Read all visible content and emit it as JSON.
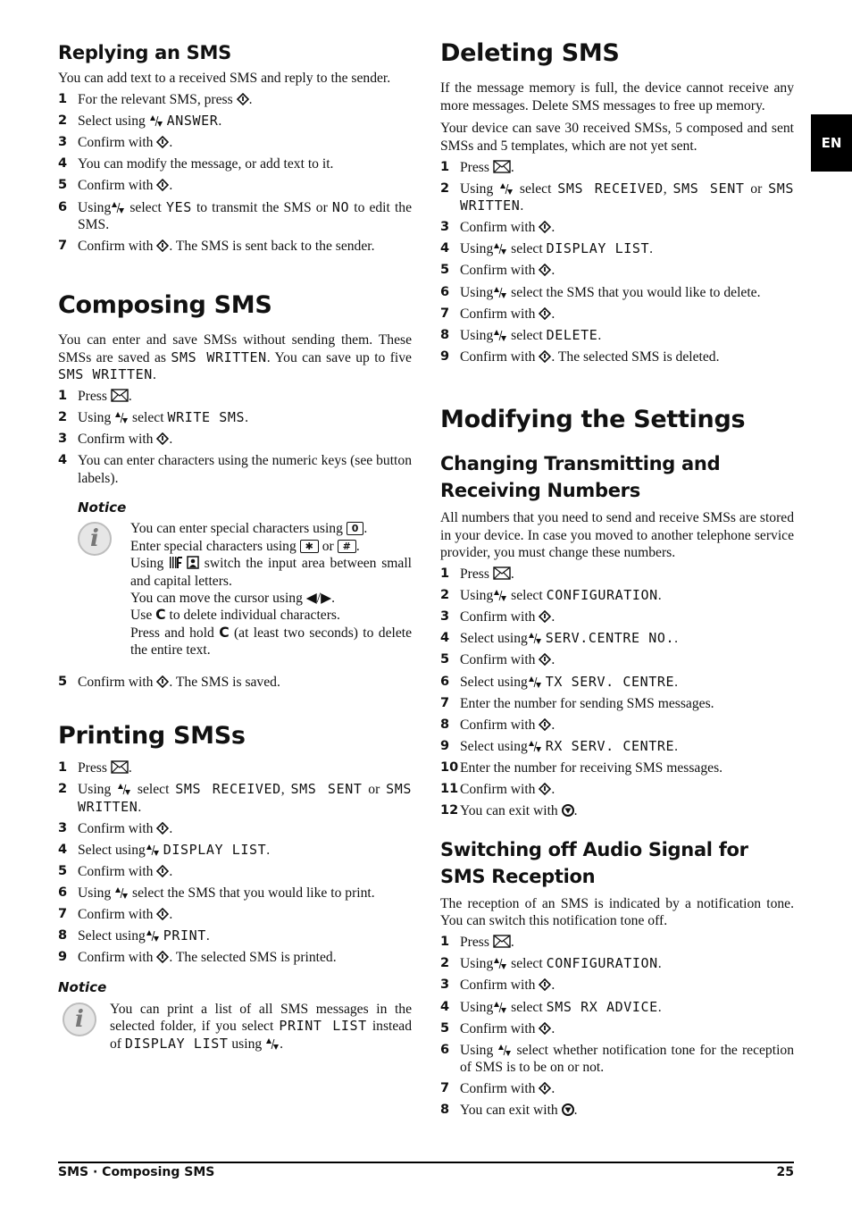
{
  "language_tab": "EN",
  "footer": {
    "section": "SMS · Composing SMS",
    "page_number": "25"
  },
  "icons": {
    "confirm": "ok-diamond-icon",
    "envelope": "envelope-icon",
    "updown": "up-down-arrows-icon",
    "stop": "stop-icon",
    "info": "info-icon"
  },
  "replying": {
    "title": "Replying an SMS",
    "intro": "You can add text to a received SMS and reply to the sender.",
    "steps": [
      {
        "n": "1",
        "pre": "For the relevant SMS, press ",
        "post": "."
      },
      {
        "n": "2",
        "pre": "Select using ",
        "lcd": "ANSWER",
        "post": "."
      },
      {
        "n": "3",
        "pre": "Confirm with ",
        "post": "."
      },
      {
        "n": "4",
        "text": "You can modify the message, or add text to it."
      },
      {
        "n": "5",
        "pre": "Confirm with ",
        "post": "."
      },
      {
        "n": "6",
        "pre": "Using",
        "mid": " select ",
        "lcd1": "YES",
        "mid2": " to transmit the SMS or ",
        "lcd2": "NO",
        "post": " to edit the SMS."
      },
      {
        "n": "7",
        "pre": "Confirm with ",
        "post": ". The SMS is sent back to the sender."
      }
    ]
  },
  "composing": {
    "title": "Composing SMS",
    "intro_a": "You can enter and save SMSs without sending them. These SMSs are saved as ",
    "intro_lcd1": "SMS WRITTEN",
    "intro_b": ". You can save up to five ",
    "intro_lcd2": "SMS WRITTEN",
    "intro_c": ".",
    "steps": [
      {
        "n": "1",
        "pre": "Press ",
        "post": "."
      },
      {
        "n": "2",
        "pre": "Using ",
        "mid": " select ",
        "lcd": "WRITE SMS",
        "post": "."
      },
      {
        "n": "3",
        "pre": "Confirm with ",
        "post": "."
      },
      {
        "n": "4",
        "text": "You can enter characters using the numeric keys (see button labels)."
      },
      {
        "n": "5",
        "pre": "Confirm with ",
        "post": ". The SMS is saved."
      }
    ],
    "notice": {
      "title": "Notice",
      "l1_pre": "You can enter special characters using ",
      "key0": "0",
      "l1_post": ".",
      "l2_pre": "Enter special characters using ",
      "key_star": "✱",
      "l2_mid": " or ",
      "key_hash": "#",
      "l2_post": ".",
      "l3_pre": "Using ",
      "l3_post": " switch the input area between small and capital letters.",
      "l4_pre": "You can move the cursor using ",
      "l4_arrows": "◀/▶",
      "l4_post": ".",
      "l5_pre": "Use ",
      "l5_key": "C",
      "l5_post": " to delete individual characters.",
      "l6_pre": "Press and hold ",
      "l6_key": "C",
      "l6_post": " (at least two seconds) to delete the entire text."
    }
  },
  "printing": {
    "title": "Printing SMSs",
    "steps": [
      {
        "n": "1",
        "pre": "Press ",
        "post": "."
      },
      {
        "n": "2",
        "pre": "Using ",
        "mid": " select ",
        "lcd1": "SMS RECEIVED",
        "sep": ", ",
        "lcd2": "SMS SENT",
        "or": " or ",
        "lcd3": "SMS WRITTEN",
        "post": "."
      },
      {
        "n": "3",
        "pre": "Confirm with ",
        "post": "."
      },
      {
        "n": "4",
        "pre": "Select using",
        "lcd": "DISPLAY LIST",
        "post": "."
      },
      {
        "n": "5",
        "pre": "Confirm with ",
        "post": "."
      },
      {
        "n": "6",
        "pre": "Using ",
        "mid": " select the SMS that you would like to print."
      },
      {
        "n": "7",
        "pre": "Confirm with ",
        "post": "."
      },
      {
        "n": "8",
        "pre": "Select using",
        "lcd": "PRINT",
        "post": "."
      },
      {
        "n": "9",
        "pre": "Confirm with ",
        "post": ". The selected SMS is printed."
      }
    ],
    "notice": {
      "title": "Notice",
      "text_a": "You can print a list of all SMS messages in the selected folder, if you select ",
      "lcd1": "PRINT LIST",
      "text_b": " instead of ",
      "lcd2": "DISPLAY LIST",
      "text_c": " using ",
      "text_d": "."
    }
  },
  "deleting": {
    "title": "Deleting SMS",
    "intro1": "If the message memory is full, the device cannot receive any more messages. Delete SMS messages to free up memory.",
    "intro2": "Your device can save 30 received SMSs, 5 composed and sent SMSs and 5 templates, which are not yet sent.",
    "steps": [
      {
        "n": "1",
        "pre": "Press ",
        "post": "."
      },
      {
        "n": "2",
        "pre": "Using ",
        "mid": " select ",
        "lcd1": "SMS RECEIVED",
        "sep": ", ",
        "lcd2": "SMS SENT",
        "or": " or ",
        "lcd3": "SMS WRITTEN",
        "post": "."
      },
      {
        "n": "3",
        "pre": "Confirm with ",
        "post": "."
      },
      {
        "n": "4",
        "pre": "Using",
        "mid": " select ",
        "lcd": "DISPLAY LIST",
        "post": "."
      },
      {
        "n": "5",
        "pre": "Confirm with ",
        "post": "."
      },
      {
        "n": "6",
        "pre": "Using",
        "mid": " select the SMS that you would like to delete."
      },
      {
        "n": "7",
        "pre": "Confirm with ",
        "post": "."
      },
      {
        "n": "8",
        "pre": "Using",
        "mid": " select ",
        "lcd": "DELETE",
        "post": "."
      },
      {
        "n": "9",
        "pre": "Confirm with ",
        "post": ". The selected SMS is deleted."
      }
    ]
  },
  "modifying": {
    "title": "Modifying the Settings",
    "numbers": {
      "title": "Changing Transmitting and Receiving Numbers",
      "intro": "All numbers that you need to send and receive SMSs are stored in your device. In case you moved to another telephone service provider, you must change these numbers.",
      "steps": [
        {
          "n": "1",
          "pre": "Press ",
          "post": "."
        },
        {
          "n": "2",
          "pre": "Using",
          "mid": " select ",
          "lcd": "CONFIGURATION",
          "post": "."
        },
        {
          "n": "3",
          "pre": "Confirm with ",
          "post": "."
        },
        {
          "n": "4",
          "pre": "Select using",
          "lcd": "SERV.CENTRE NO.",
          "post": "."
        },
        {
          "n": "5",
          "pre": "Confirm with ",
          "post": "."
        },
        {
          "n": "6",
          "pre": "Select using",
          "lcd": "TX SERV. CENTRE",
          "post": "."
        },
        {
          "n": "7",
          "text": "Enter the number for sending SMS messages."
        },
        {
          "n": "8",
          "pre": "Confirm with ",
          "post": "."
        },
        {
          "n": "9",
          "pre": "Select using",
          "lcd": "RX SERV. CENTRE",
          "post": "."
        },
        {
          "n": "10",
          "text": "Enter the number for receiving SMS messages."
        },
        {
          "n": "11",
          "pre": "Confirm with ",
          "post": "."
        },
        {
          "n": "12",
          "pre": "You can exit with ",
          "post": "."
        }
      ]
    },
    "audio": {
      "title": "Switching off Audio Signal for SMS Reception",
      "intro": "The reception of an SMS is indicated by a notification tone. You can switch this notification tone off.",
      "steps": [
        {
          "n": "1",
          "pre": "Press ",
          "post": "."
        },
        {
          "n": "2",
          "pre": "Using",
          "mid": " select ",
          "lcd": "CONFIGURATION",
          "post": "."
        },
        {
          "n": "3",
          "pre": "Confirm with ",
          "post": "."
        },
        {
          "n": "4",
          "pre": "Using",
          "mid": " select ",
          "lcd": "SMS RX ADVICE",
          "post": "."
        },
        {
          "n": "5",
          "pre": "Confirm with ",
          "post": "."
        },
        {
          "n": "6",
          "pre": "Using ",
          "mid": " select whether notification tone for the reception of SMS is to be on or not."
        },
        {
          "n": "7",
          "pre": "Confirm with ",
          "post": "."
        },
        {
          "n": "8",
          "pre": "You can exit with ",
          "post": "."
        }
      ]
    }
  }
}
